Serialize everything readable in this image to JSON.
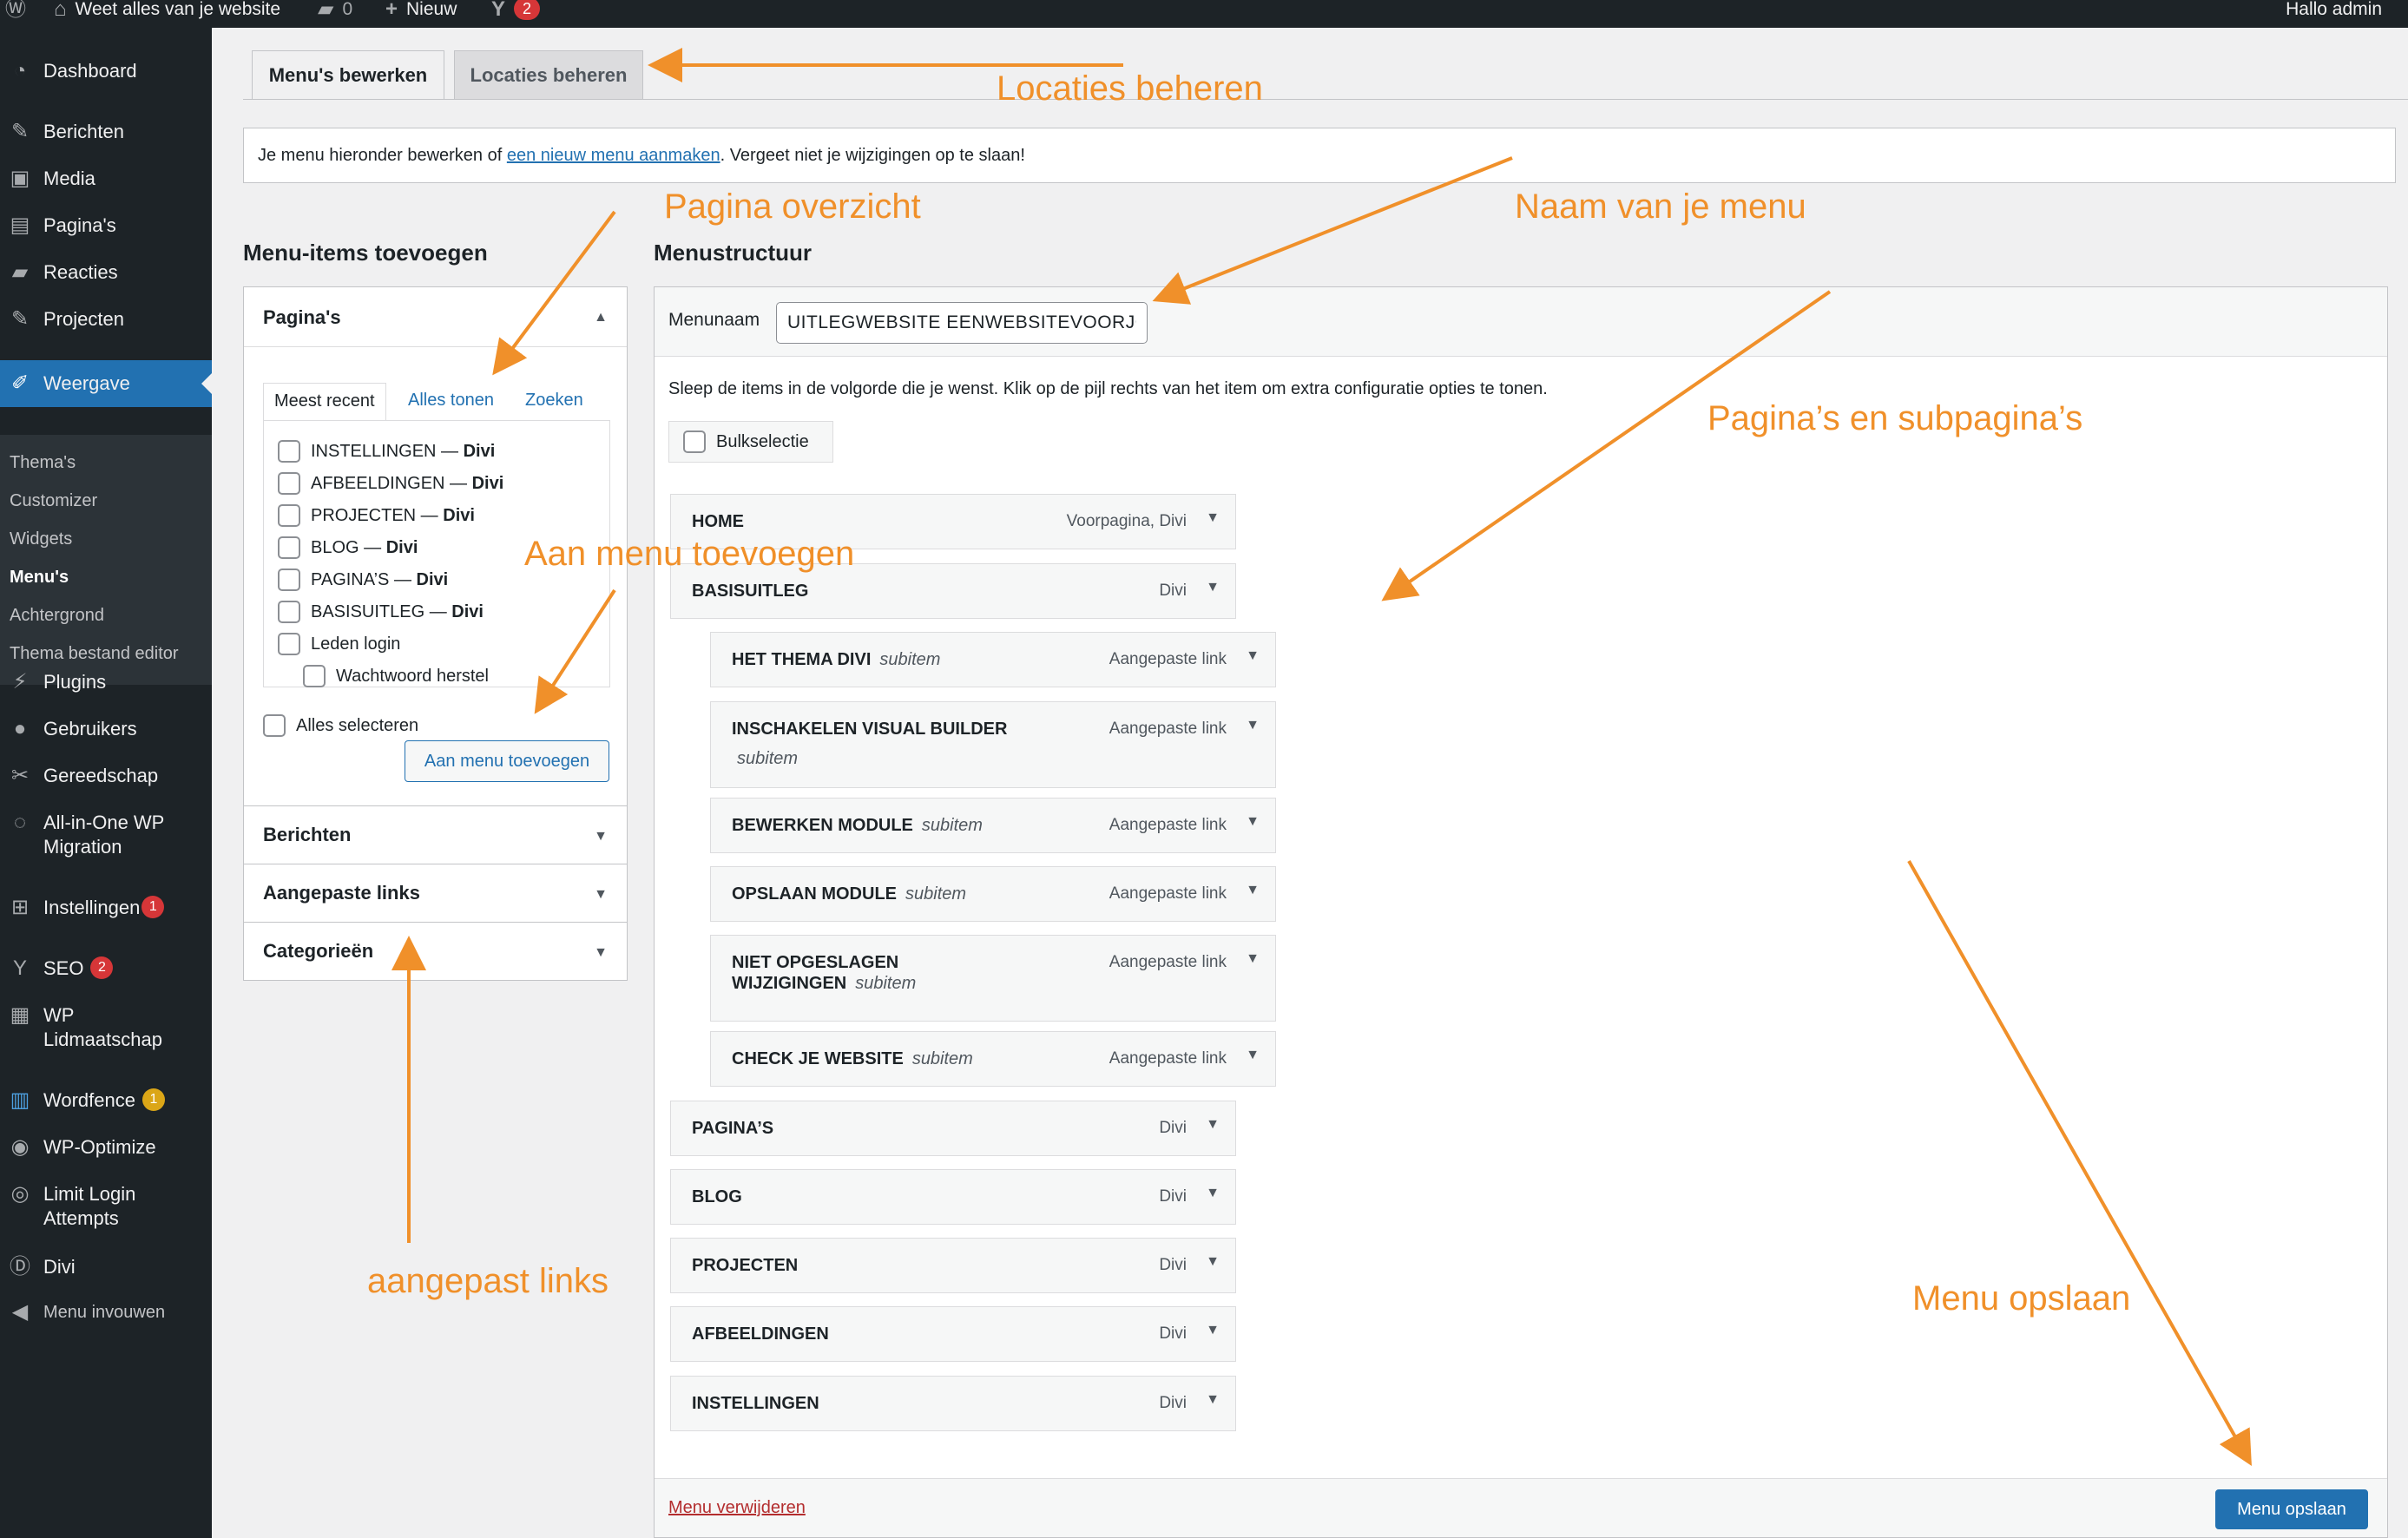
{
  "adminbar": {
    "site_name": "Weet alles van je website",
    "comments_count": "0",
    "new_label": "Nieuw",
    "yoast_badge": "2",
    "greeting": "Hallo admin"
  },
  "sidebar": {
    "items": [
      {
        "label": "Dashboard",
        "icon": "dashboard-icon"
      },
      {
        "label": "Berichten",
        "icon": "pin-icon"
      },
      {
        "label": "Media",
        "icon": "media-icon"
      },
      {
        "label": "Pagina's",
        "icon": "page-icon"
      },
      {
        "label": "Reacties",
        "icon": "comment-icon"
      },
      {
        "label": "Projecten",
        "icon": "pin-icon"
      },
      {
        "label": "Weergave",
        "icon": "brush-icon"
      },
      {
        "label": "Plugins",
        "icon": "plug-icon"
      },
      {
        "label": "Gebruikers",
        "icon": "users-icon"
      },
      {
        "label": "Gereedschap",
        "icon": "wrench-icon"
      },
      {
        "label": "All-in-One WP",
        "label2": "Migration",
        "icon": "migration-icon"
      },
      {
        "label": "Instellingen",
        "icon": "settings-icon",
        "badge": "1"
      },
      {
        "label": "SEO",
        "icon": "yoast-icon",
        "badge": "2"
      },
      {
        "label": "WP",
        "label2": "Lidmaatschap",
        "icon": "membership-icon"
      },
      {
        "label": "Wordfence",
        "icon": "wordfence-icon",
        "badge": "1"
      },
      {
        "label": "WP-Optimize",
        "icon": "optimize-icon"
      },
      {
        "label": "Limit Login",
        "label2": "Attempts",
        "icon": "fingerprint-icon"
      },
      {
        "label": "Divi",
        "icon": "divi-icon"
      },
      {
        "label": "Menu invouwen",
        "icon": "collapse-icon"
      }
    ],
    "submenu": [
      "Thema's",
      "Customizer",
      "Widgets",
      "Menu's",
      "Achtergrond",
      "Thema bestand editor"
    ]
  },
  "tabs": {
    "edit": "Menu's bewerken",
    "locations": "Locaties beheren"
  },
  "notice": {
    "before": "Je menu hieronder bewerken of ",
    "link": "een nieuw menu aanmaken",
    "after": ". Vergeet niet je wijzigingen op te slaan!"
  },
  "left": {
    "title": "Menu-items toevoegen",
    "pages_section": "Pagina's",
    "inner_tabs": [
      "Meest recent",
      "Alles tonen",
      "Zoeken"
    ],
    "pages": [
      {
        "name": "INSTELLINGEN",
        "suffix": "Divi"
      },
      {
        "name": "AFBEELDINGEN",
        "suffix": "Divi"
      },
      {
        "name": "PROJECTEN",
        "suffix": "Divi"
      },
      {
        "name": "BLOG",
        "suffix": "Divi"
      },
      {
        "name": "PAGINA’S",
        "suffix": "Divi"
      },
      {
        "name": "BASISUITLEG",
        "suffix": "Divi"
      },
      {
        "name": "Leden login",
        "suffix": ""
      },
      {
        "name": "Wachtwoord herstel",
        "suffix": ""
      }
    ],
    "select_all": "Alles selecteren",
    "add_button": "Aan menu toevoegen",
    "sections": [
      "Berichten",
      "Aangepaste links",
      "Categorieën"
    ]
  },
  "right": {
    "title": "Menustructuur",
    "menu_name_label": "Menunaam",
    "menu_name_value": "UITLEGWEBSITE EENWEBSITEVOORJC",
    "instructions": "Sleep de items in de volgorde die je wenst. Klik op de pijl rechts van het item om extra configuratie opties te tonen.",
    "bulk_label": "Bulkselectie",
    "items": [
      {
        "title": "HOME",
        "sub": "",
        "type": "Voorpagina, Divi"
      },
      {
        "title": "BASISUITLEG",
        "sub": "",
        "type": "Divi"
      },
      {
        "title": "HET THEMA DIVI",
        "sub": "subitem",
        "type": "Aangepaste link"
      },
      {
        "title": "INSCHAKELEN VISUAL BUILDER",
        "sub": "subitem",
        "type": "Aangepaste link"
      },
      {
        "title": "BEWERKEN MODULE",
        "sub": "subitem",
        "type": "Aangepaste link"
      },
      {
        "title": "OPSLAAN MODULE",
        "sub": "subitem",
        "type": "Aangepaste link"
      },
      {
        "title": "NIET OPGESLAGEN",
        "title2": "WIJZIGINGEN",
        "sub": "subitem",
        "type": "Aangepaste link"
      },
      {
        "title": "CHECK JE WEBSITE",
        "sub": "subitem",
        "type": "Aangepaste link"
      },
      {
        "title": "PAGINA’S",
        "sub": "",
        "type": "Divi"
      },
      {
        "title": "BLOG",
        "sub": "",
        "type": "Divi"
      },
      {
        "title": "PROJECTEN",
        "sub": "",
        "type": "Divi"
      },
      {
        "title": "AFBEELDINGEN",
        "sub": "",
        "type": "Divi"
      },
      {
        "title": "INSTELLINGEN",
        "sub": "",
        "type": "Divi"
      }
    ],
    "delete_link": "Menu verwijderen",
    "save_button": "Menu opslaan"
  },
  "annotations": {
    "locations": "Locaties beheren",
    "page_overview": "Pagina overzicht",
    "menu_name": "Naam van je menu",
    "pages_subpages": "Pagina’s en subpagina’s",
    "add_to_menu": "Aan menu toevoegen",
    "custom_links": "aangepast links",
    "save_menu": "Menu opslaan",
    "color": "#f0902a"
  },
  "colors": {
    "admin_dark": "#1d2327",
    "accent": "#2271b1",
    "badge_red": "#d63638",
    "badge_yellow": "#dba617",
    "annotation": "#f0902a"
  }
}
